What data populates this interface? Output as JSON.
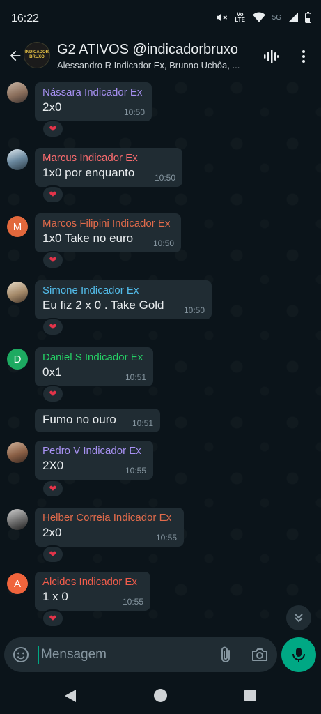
{
  "status_bar": {
    "time": "16:22",
    "icons": [
      "mute-icon",
      "volte-icon",
      "wifi-icon",
      "5g-signal-icon",
      "signal-icon",
      "battery-icon"
    ],
    "network_label": "5G",
    "volte_label": "Vo LTE"
  },
  "header": {
    "title": "G2 ATIVOS @indicadorbruxo",
    "subtitle": "Alessandro R Indicador Ex, Brunno Uchôa, ...",
    "avatar_text": "INDICADOR BRUXO"
  },
  "messages": [
    {
      "sender": "Nássara Indicador Ex",
      "sender_color": "#a791f2",
      "text": "2x0",
      "time": "10:50",
      "reaction": "❤"
    },
    {
      "sender": "Marcus Indicador Ex",
      "sender_color": "#fc6c6f",
      "text": "1x0 por enquanto",
      "time": "10:50",
      "reaction": "❤"
    },
    {
      "sender": "Marcos Filipini Indicador Ex",
      "sender_color": "#e26b4b",
      "avatar_letter": "M",
      "avatar_color": "#e2683c",
      "text": "1x0 Take no euro",
      "time": "10:50",
      "reaction": "❤"
    },
    {
      "sender": "Simone Indicador Ex",
      "sender_color": "#53bdeb",
      "text": "Eu fiz 2 x 0 . Take Gold",
      "time": "10:50",
      "reaction": "❤"
    },
    {
      "sender": "Daniel S Indicador Ex",
      "sender_color": "#25d366",
      "avatar_letter": "D",
      "avatar_color": "#1daa61",
      "text": "0x1",
      "time": "10:51",
      "reaction": "❤"
    },
    {
      "text": "Fumo no ouro",
      "time": "10:51"
    },
    {
      "sender": "Pedro V Indicador Ex",
      "sender_color": "#a791f2",
      "text": "2X0",
      "time": "10:55",
      "reaction": "❤"
    },
    {
      "sender": "Helber Correia Indicador Ex",
      "sender_color": "#e26b4b",
      "text": "2x0",
      "time": "10:55",
      "reaction": "❤"
    },
    {
      "sender": "Alcides Indicador Ex",
      "sender_color": "#f15c4b",
      "avatar_letter": "A",
      "avatar_color": "#f0643c",
      "text": "1 x 0",
      "time": "10:55",
      "reaction": "❤"
    }
  ],
  "composer": {
    "placeholder": "Mensagem"
  },
  "colors": {
    "accent": "#00a884",
    "bubble": "#202c33",
    "background": "#0b141a"
  }
}
